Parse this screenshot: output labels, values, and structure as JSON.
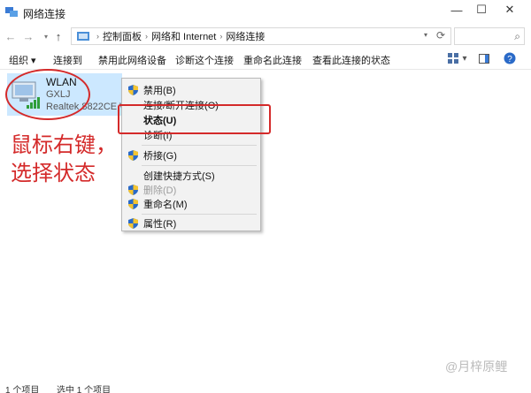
{
  "window": {
    "title": "网络连接",
    "minimize_glyph": "—",
    "maximize_glyph": "☐",
    "close_glyph": "✕"
  },
  "address": {
    "crumbs": [
      "控制面板",
      "网络和 Internet",
      "网络连接"
    ],
    "separator": "›",
    "dropdown_glyph": "▾",
    "refresh_glyph": "⟳",
    "search_glyph": "⌕"
  },
  "nav": {
    "back_glyph": "←",
    "forward_glyph": "→",
    "recent_glyph": "▾",
    "up_glyph": "↑"
  },
  "commands": [
    "组织 ▾",
    "连接到",
    "禁用此网络设备",
    "诊断这个连接",
    "重命名此连接",
    "查看此连接的状态"
  ],
  "connection": {
    "name": "WLAN",
    "ssid": "GXLJ",
    "adapter": "Realtek 8822CE Wi..."
  },
  "context_menu": [
    {
      "label": "禁用(B)",
      "shield": true,
      "bold": false,
      "disabled": false
    },
    {
      "label": "连接/断开连接(O)",
      "shield": false,
      "bold": false,
      "disabled": false
    },
    {
      "label": "状态(U)",
      "shield": false,
      "bold": true,
      "disabled": false
    },
    {
      "label": "诊断(I)",
      "shield": false,
      "bold": false,
      "disabled": false
    },
    {
      "label": "桥接(G)",
      "shield": true,
      "bold": false,
      "disabled": false
    },
    {
      "label": "创建快捷方式(S)",
      "shield": false,
      "bold": false,
      "disabled": false
    },
    {
      "label": "删除(D)",
      "shield": true,
      "bold": false,
      "disabled": true
    },
    {
      "label": "重命名(M)",
      "shield": true,
      "bold": false,
      "disabled": false
    },
    {
      "label": "属性(R)",
      "shield": true,
      "bold": false,
      "disabled": false
    }
  ],
  "annotation": {
    "line1": "鼠标右键，",
    "line2": "选择状态",
    "color": "#d42a2a"
  },
  "statusbar": {
    "count": "1 个项目",
    "selected": "选中 1 个项目"
  },
  "watermark": "@月梓原鲤",
  "colors": {
    "selection": "#cce8ff",
    "menu_bg": "#f2f2f2"
  }
}
